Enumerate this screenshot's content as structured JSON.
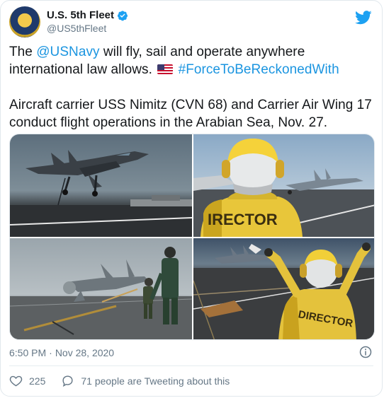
{
  "account": {
    "display_name": "U.S. 5th Fleet",
    "handle": "@US5thFleet",
    "avatar_icon": "fleet-seal-avatar",
    "verified_icon": "verified-badge-icon"
  },
  "tweet": {
    "line1_prefix": "The ",
    "mention": "@USNavy",
    "line1_suffix": " will fly, sail and operate anywhere international law allows. ",
    "flag_icon": "us-flag-emoji",
    "hashtag": "#ForceToBeReckonedWith",
    "paragraph2": "Aircraft carrier USS Nimitz (CVN 68) and Carrier Air Wing 17 conduct flight operations in the Arabian Sea, Nov. 27."
  },
  "photos": {
    "p2_vest_text": "IRECTOR",
    "p4_vest_text": "DIRECTOR"
  },
  "meta": {
    "time": "6:50 PM",
    "separator": "·",
    "date": "Nov 28, 2020"
  },
  "actions": {
    "likes": "225",
    "tweeting": "71 people are Tweeting about this"
  },
  "colors": {
    "link": "#1b95e0",
    "twitter_blue": "#1da1f2",
    "like_red": "#e0245e",
    "muted": "#657786"
  }
}
